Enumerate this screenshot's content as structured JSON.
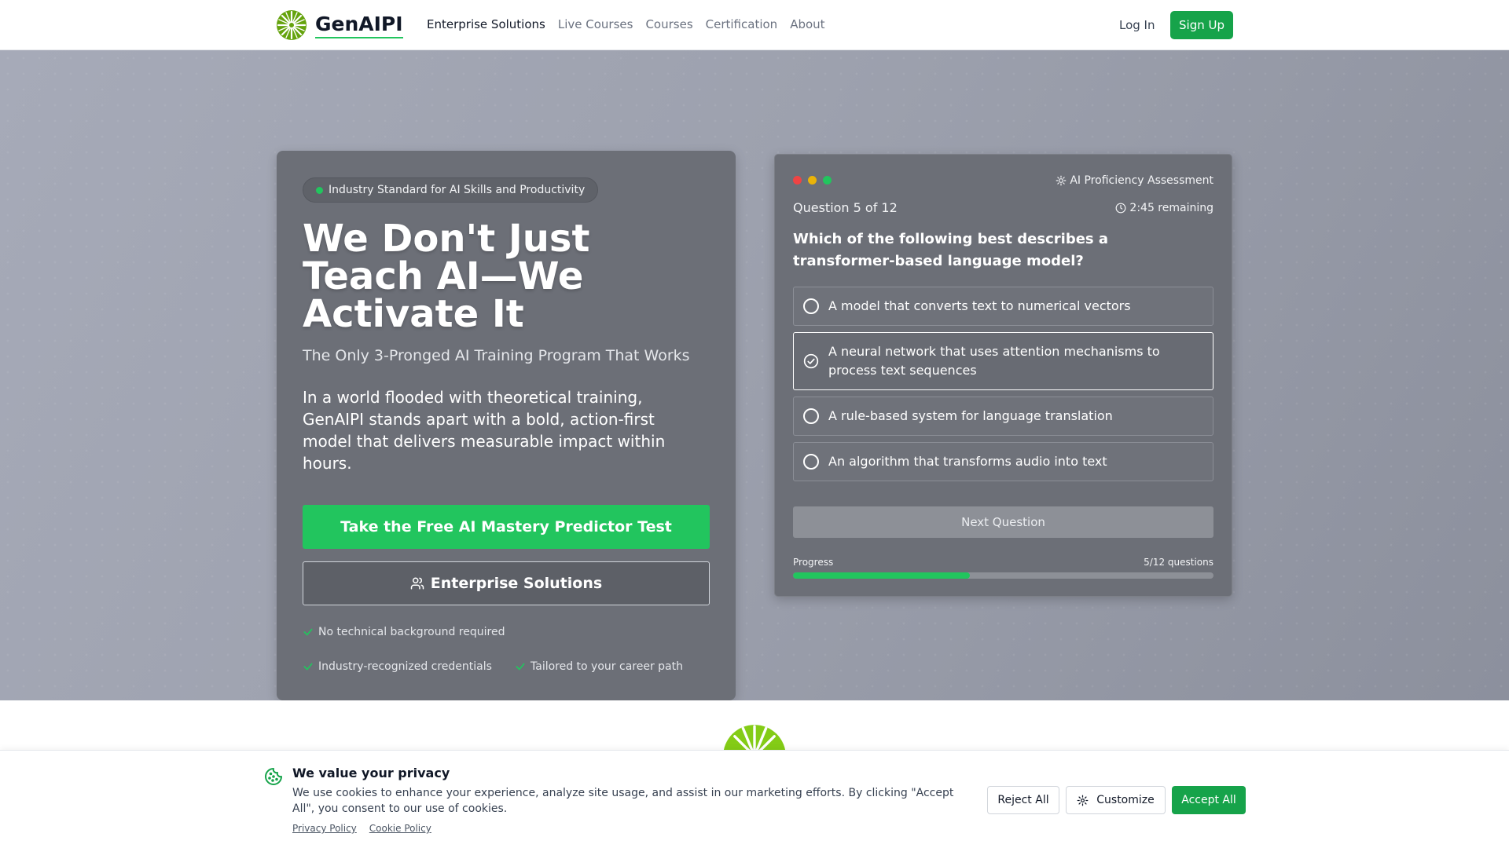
{
  "nav": {
    "brand": "GenAIPI",
    "links": [
      {
        "label": "Enterprise Solutions",
        "active": true
      },
      {
        "label": "Live Courses",
        "active": false
      },
      {
        "label": "Courses",
        "active": false
      },
      {
        "label": "Certification",
        "active": false
      },
      {
        "label": "About",
        "active": false
      }
    ],
    "login_label": "Log In",
    "signup_label": "Sign Up"
  },
  "hero": {
    "badge": "Industry Standard for AI Skills and Productivity",
    "headline": "We Don't Just Teach AI—We Activate It",
    "subhead": "The Only 3-Pronged AI Training Program That Works",
    "body": "In a world flooded with theoretical training, GenAIPI stands apart with a bold, action-first model that delivers measurable impact within hours.",
    "cta_primary": "Take the Free AI Mastery Predictor Test",
    "cta_secondary": "Enterprise Solutions",
    "features": [
      "No technical background required",
      "Industry-recognized credentials",
      "Tailored to your career path"
    ]
  },
  "quiz": {
    "title": "AI Proficiency Assessment",
    "question_number": "Question 5 of 12",
    "timer": "2:45 remaining",
    "question": "Which of the following best describes a transformer-based language model?",
    "options": [
      {
        "text": "A model that converts text to numerical vectors",
        "selected": false
      },
      {
        "text": "A neural network that uses attention mechanisms to process text sequences",
        "selected": true
      },
      {
        "text": "A rule-based system for language translation",
        "selected": false
      },
      {
        "text": "An algorithm that transforms audio into text",
        "selected": false
      }
    ],
    "next_label": "Next Question",
    "progress_label": "Progress",
    "progress_count": "5/12 questions",
    "progress_value": 0.42
  },
  "cookie": {
    "title": "We value your privacy",
    "text": "We use cookies to enhance your experience, analyze site usage, and assist in our marketing efforts. By clicking \"Accept All\", you consent to our use of cookies.",
    "privacy_link": "Privacy Policy",
    "cookie_link": "Cookie Policy",
    "reject_label": "Reject All",
    "customize_label": "Customize",
    "accept_label": "Accept All"
  },
  "colors": {
    "brand_green": "#16a34a",
    "accent_green": "#22c55e",
    "logo_green": "#84cc16",
    "dot_red": "#ef4444",
    "dot_yellow": "#eab308",
    "dot_green": "#22c55e"
  },
  "icons": {
    "logo": "sunburst-logo-icon",
    "badge_dot": "status-dot-icon",
    "enterprise": "users-icon",
    "feature_check": "check-icon",
    "quiz_title": "sun-icon",
    "timer": "clock-icon",
    "selected_option": "check-circle-icon",
    "cookie": "cookie-icon",
    "customize": "gear-icon"
  }
}
